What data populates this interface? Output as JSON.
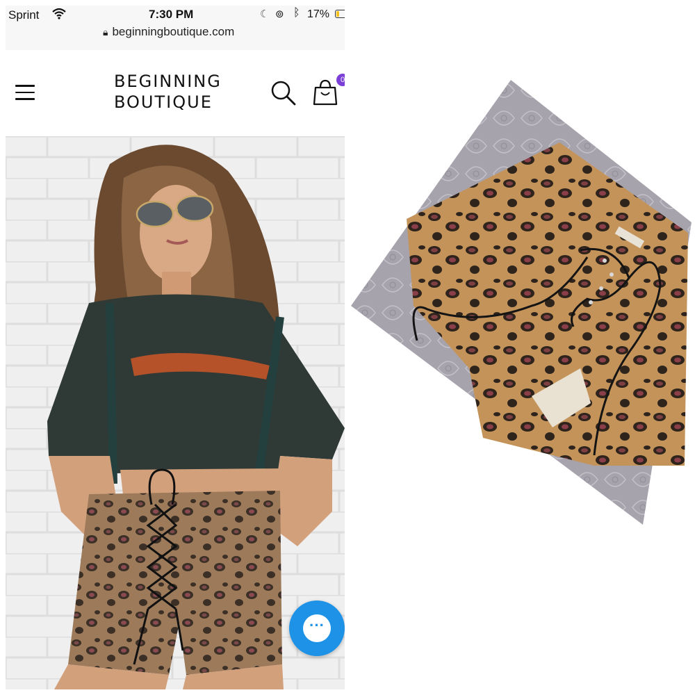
{
  "status_bar": {
    "carrier": "Sprint",
    "time": "7:30 PM",
    "battery": "17%",
    "url": "beginningboutique.com"
  },
  "header": {
    "logo_line1": "BEGINNING",
    "logo_line2": "BOUTIQUE",
    "cart_count": "0"
  },
  "colors": {
    "accent": "#7a3fd6",
    "chat": "#1e92e6",
    "leopard_base": "#b98a56"
  },
  "icons": [
    "wifi-icon",
    "moon-icon",
    "rotation-lock-icon",
    "bluetooth-icon",
    "battery-icon",
    "padlock-icon",
    "hamburger-menu-icon",
    "search-icon",
    "shopping-bag-icon",
    "chat-dots-icon"
  ]
}
